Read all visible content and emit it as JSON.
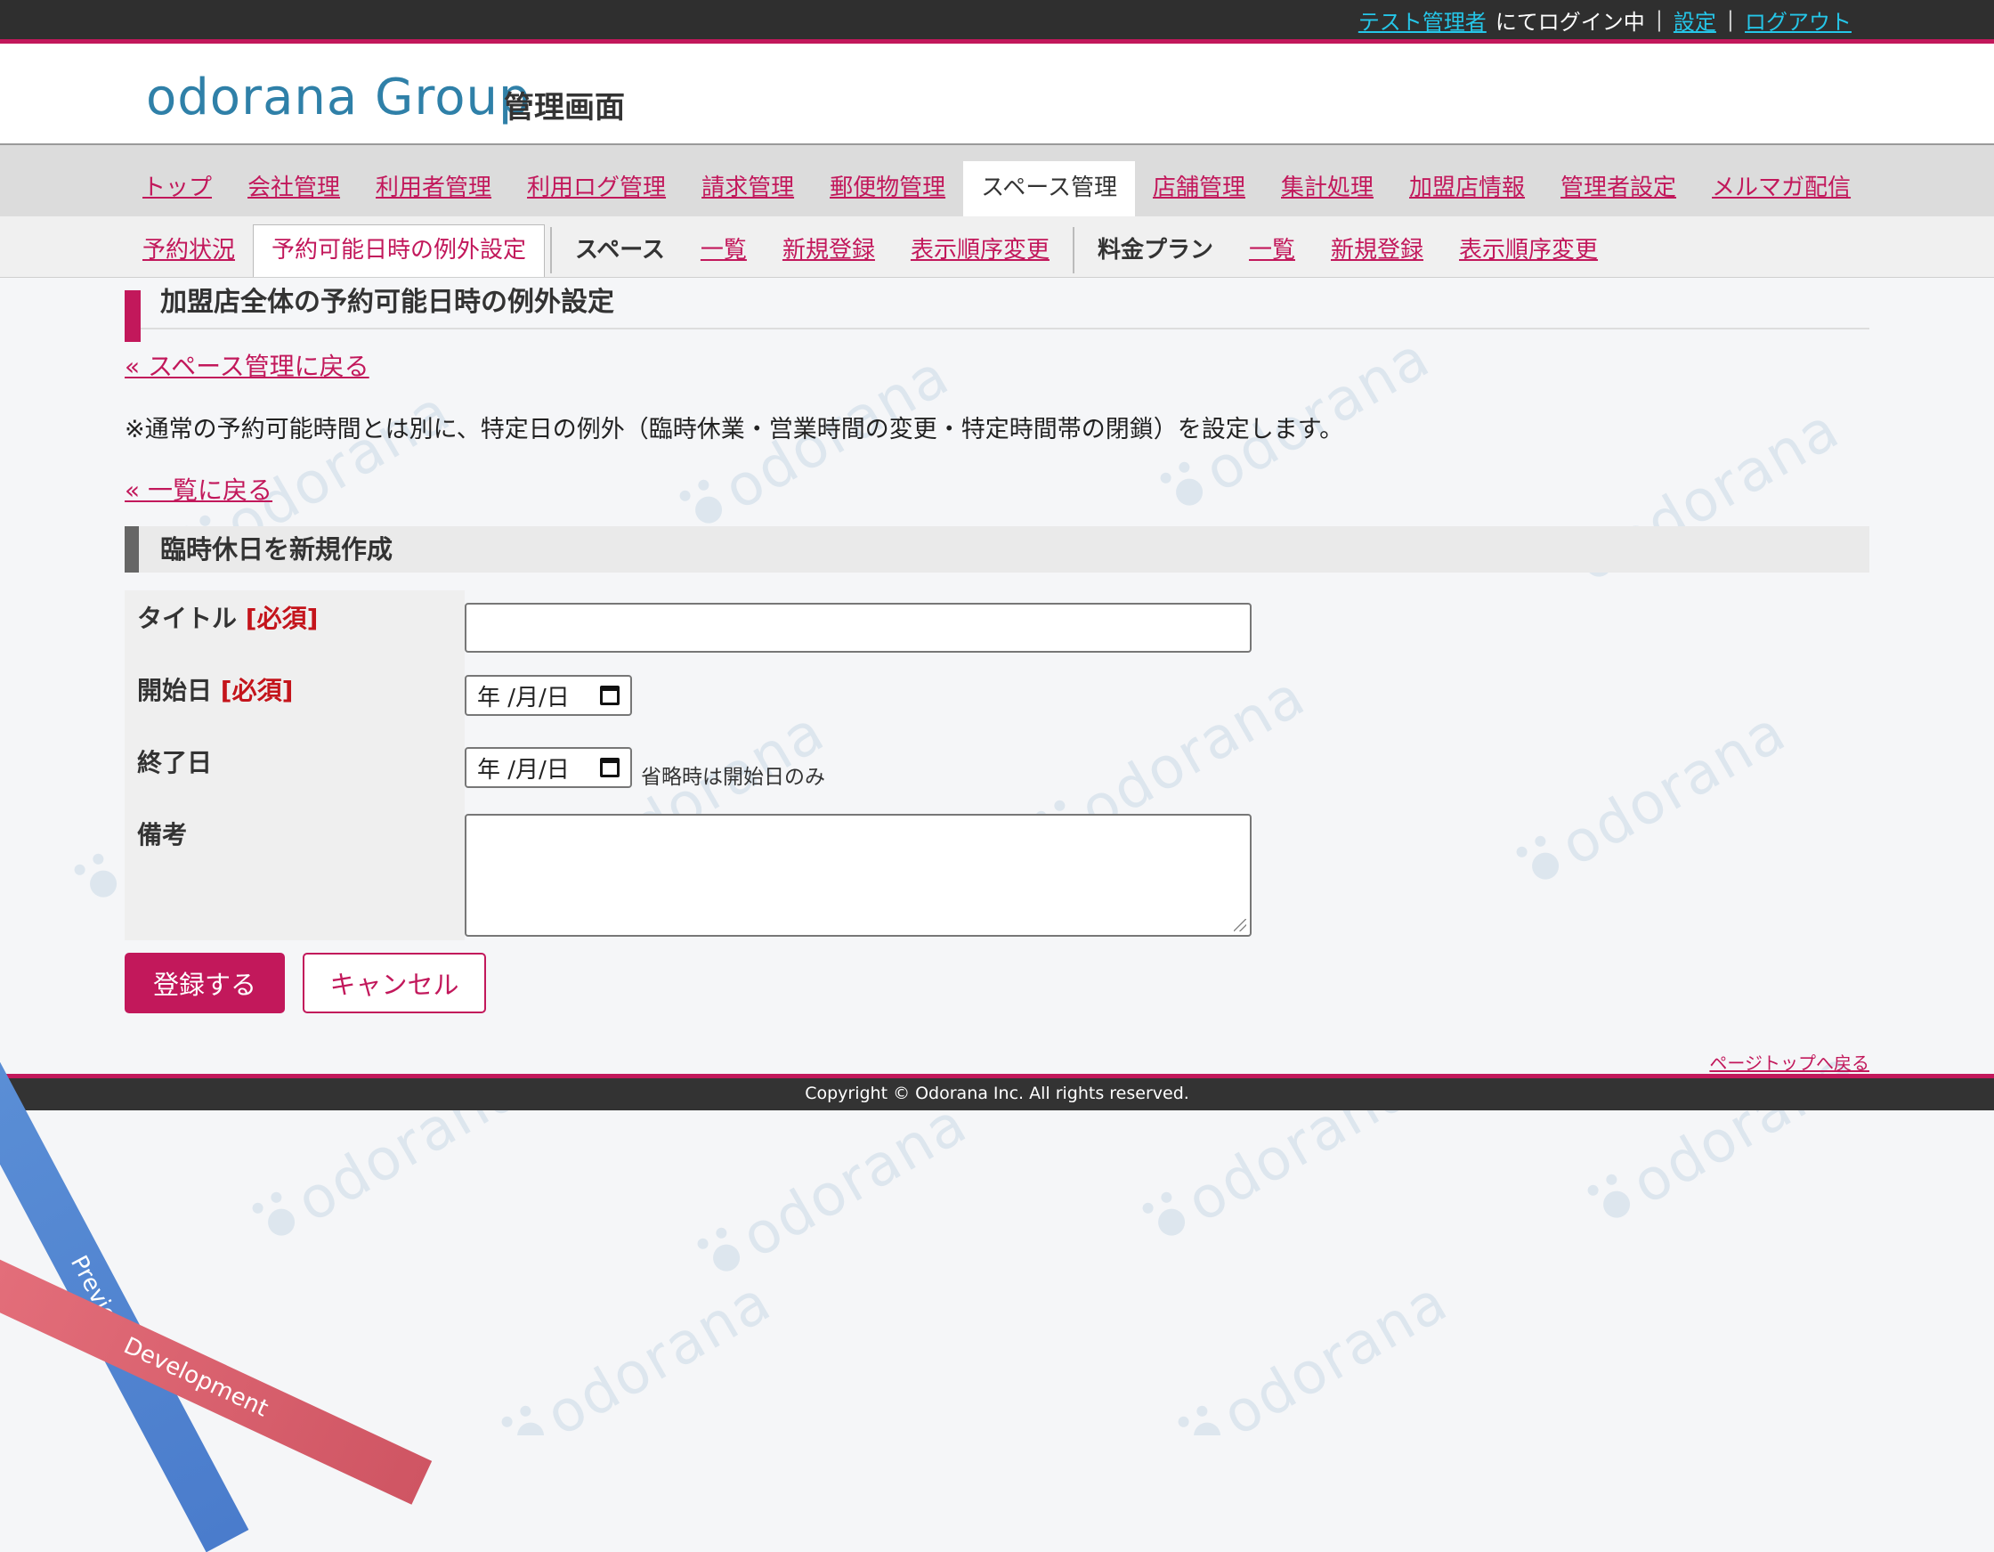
{
  "topbar": {
    "user_link": "テスト管理者",
    "logged_in_text": "にてログイン中",
    "settings_link": "設定",
    "logout_link": "ログアウト"
  },
  "header": {
    "logo": "odorana Group",
    "subtitle": "管理画面"
  },
  "main_nav": [
    {
      "label": "トップ",
      "active": false
    },
    {
      "label": "会社管理",
      "active": false
    },
    {
      "label": "利用者管理",
      "active": false
    },
    {
      "label": "利用ログ管理",
      "active": false
    },
    {
      "label": "請求管理",
      "active": false
    },
    {
      "label": "郵便物管理",
      "active": false
    },
    {
      "label": "スペース管理",
      "active": true
    },
    {
      "label": "店舗管理",
      "active": false
    },
    {
      "label": "集計処理",
      "active": false
    },
    {
      "label": "加盟店情報",
      "active": false
    },
    {
      "label": "管理者設定",
      "active": false
    },
    {
      "label": "メルマガ配信",
      "active": false
    }
  ],
  "sub_nav": {
    "reservation_status": "予約状況",
    "exception_settings": "予約可能日時の例外設定",
    "space_label": "スペース",
    "space_list": "一覧",
    "space_new": "新規登録",
    "space_order": "表示順序変更",
    "plan_label": "料金プラン",
    "plan_list": "一覧",
    "plan_new": "新規登録",
    "plan_order": "表示順序変更"
  },
  "page": {
    "title": "加盟店全体の予約可能日時の例外設定",
    "back_to_space": "« スペース管理に戻る",
    "note": "※通常の予約可能時間とは別に、特定日の例外（臨時休業・営業時間の変更・特定時間帯の閉鎖）を設定します。",
    "back_to_list": "« 一覧に戻る",
    "section_title": "臨時休日を新規作成"
  },
  "form": {
    "title_label": "タイトル",
    "start_label": "開始日",
    "end_label": "終了日",
    "memo_label": "備考",
    "required": "[必須]",
    "title_value": "",
    "start_placeholder": "年 /月/日",
    "end_placeholder": "年 /月/日",
    "end_hint": "省略時は開始日のみ",
    "memo_value": "",
    "submit": "登録する",
    "cancel": "キャンセル"
  },
  "footer": {
    "page_top": "ページトップへ戻る",
    "copyright": "Copyright © Odorana Inc. All rights reserved."
  },
  "ribbons": {
    "preview": "Preview",
    "development": "Development"
  },
  "watermark": "odorana",
  "colors": {
    "accent": "#c2185b",
    "topbar": "#2f2f2f",
    "link_top": "#25c6e8"
  }
}
